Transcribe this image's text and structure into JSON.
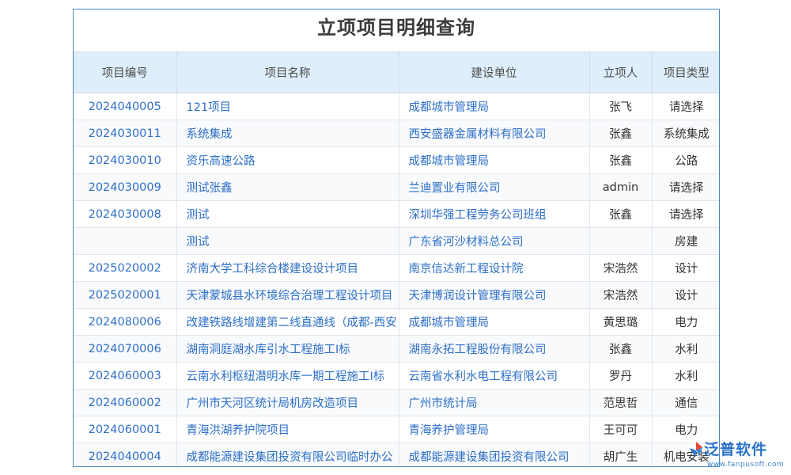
{
  "title": "立项项目明细查询",
  "columns": {
    "code": "项目编号",
    "name": "项目名称",
    "unit": "建设单位",
    "person": "立项人",
    "type": "项目类型"
  },
  "rows": [
    {
      "code": "2024040005",
      "name": "121项目",
      "unit": "成都城市管理局",
      "person": "张飞",
      "type": "请选择"
    },
    {
      "code": "2024030011",
      "name": "系统集成",
      "unit": "西安盛器金属材料有限公司",
      "person": "张鑫",
      "type": "系统集成"
    },
    {
      "code": "2024030010",
      "name": "资乐高速公路",
      "unit": "成都城市管理局",
      "person": "张鑫",
      "type": "公路"
    },
    {
      "code": "2024030009",
      "name": "测试张鑫",
      "unit": "兰迪置业有限公司",
      "person": "admin",
      "type": "请选择"
    },
    {
      "code": "2024030008",
      "name": "测试",
      "unit": "深圳华强工程劳务公司班组",
      "person": "张鑫",
      "type": "请选择"
    },
    {
      "code": "",
      "name": "测试",
      "unit": "广东省河沙材料总公司",
      "person": "",
      "type": "房建"
    },
    {
      "code": "2025020002",
      "name": "济南大学工科综合楼建设设计项目",
      "unit": "南京信达新工程设计院",
      "person": "宋浩然",
      "type": "设计"
    },
    {
      "code": "2025020001",
      "name": "天津蒙城县水环境综合治理工程设计项目",
      "unit": "天津博润设计管理有限公司",
      "person": "宋浩然",
      "type": "设计"
    },
    {
      "code": "2024080006",
      "name": "改建铁路线增建第二线直通线（成都-西安",
      "unit": "成都城市管理局",
      "person": "黄思璐",
      "type": "电力"
    },
    {
      "code": "2024070006",
      "name": "湖南洞庭湖水库引水工程施工I标",
      "unit": "湖南永拓工程股份有限公司",
      "person": "张鑫",
      "type": "水利"
    },
    {
      "code": "2024060003",
      "name": "云南水利枢纽潜明水库一期工程施工I标",
      "unit": "云南省水利水电工程有限公司",
      "person": "罗丹",
      "type": "水利"
    },
    {
      "code": "2024060002",
      "name": "广州市天河区统计局机房改造项目",
      "unit": "广州市统计局",
      "person": "范思哲",
      "type": "通信"
    },
    {
      "code": "2024060001",
      "name": "青海洪湖养护院项目",
      "unit": "青海养护管理局",
      "person": "王可可",
      "type": "电力"
    },
    {
      "code": "2024040004",
      "name": "成都能源建设集团投资有限公司临时办公",
      "unit": "成都能源建设集团投资有限公司",
      "person": "胡广生",
      "type": "机电安装"
    }
  ],
  "watermark": {
    "brand": "泛普软件",
    "url": "www.fanpusoft.com",
    "logo_icon": "fanpu-logo-icon"
  },
  "colors": {
    "link": "#2e6fc7",
    "header_bg": "#dfeefc",
    "border": "#4a86c9"
  }
}
